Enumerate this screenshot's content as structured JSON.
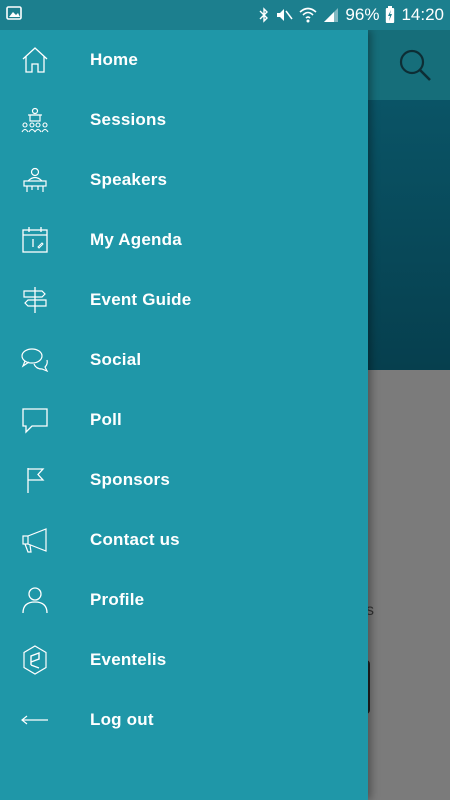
{
  "status_bar": {
    "battery": "96%",
    "time": "14:20",
    "icons": [
      "image-icon",
      "bluetooth-icon",
      "mute-icon",
      "wifi-icon",
      "signal-icon",
      "battery-charging-icon"
    ]
  },
  "app": {
    "search_icon": "search-icon",
    "partial_text": "s"
  },
  "drawer": {
    "items": [
      {
        "label": "Home",
        "icon": "home-icon"
      },
      {
        "label": "Sessions",
        "icon": "sessions-icon"
      },
      {
        "label": "Speakers",
        "icon": "speaker-icon"
      },
      {
        "label": "My Agenda",
        "icon": "calendar-icon"
      },
      {
        "label": "Event Guide",
        "icon": "signpost-icon"
      },
      {
        "label": "Social",
        "icon": "chat-bubbles-icon"
      },
      {
        "label": "Poll",
        "icon": "speech-bubble-icon"
      },
      {
        "label": "Sponsors",
        "icon": "flag-icon"
      },
      {
        "label": "Contact us",
        "icon": "megaphone-icon"
      },
      {
        "label": "Profile",
        "icon": "user-icon"
      },
      {
        "label": "Eventelis",
        "icon": "eventelis-logo-icon"
      },
      {
        "label": "Log out",
        "icon": "arrow-left-icon"
      }
    ]
  },
  "colors": {
    "drawer_bg": "#1f97a8",
    "status_bar_bg": "#1c7f8e",
    "toolbar_bg": "#166e7a",
    "hero_bg": "#063f4e",
    "scrim_bg": "#7b7b7b",
    "text": "#ffffff"
  }
}
